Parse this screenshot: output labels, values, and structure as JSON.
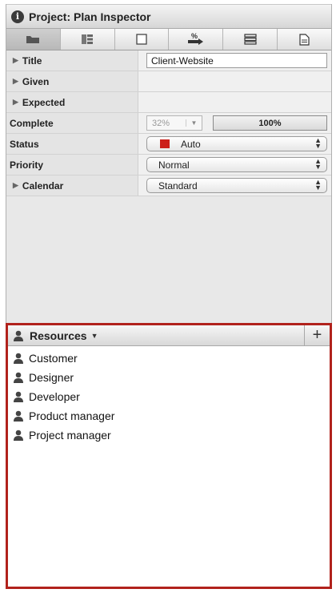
{
  "inspector": {
    "title": "Project: Plan Inspector",
    "toolbar": [
      "folder-icon",
      "database-icon",
      "page-icon",
      "percent-icon",
      "list-icon",
      "document-icon"
    ],
    "rows": {
      "title_label": "Title",
      "title_value": "Client-Website",
      "given_label": "Given",
      "expected_label": "Expected",
      "complete_label": "Complete",
      "complete_percent": "32%",
      "complete_bar_label": "100%",
      "status_label": "Status",
      "status_value": "Auto",
      "status_color": "#cc1f1a",
      "priority_label": "Priority",
      "priority_value": "Normal",
      "calendar_label": "Calendar",
      "calendar_value": "Standard"
    }
  },
  "resources": {
    "title": "Resources",
    "add_label": "+",
    "items": [
      "Customer",
      "Designer",
      "Developer",
      "Product manager",
      "Project manager"
    ]
  },
  "colors": {
    "highlight": "#b1221c"
  }
}
